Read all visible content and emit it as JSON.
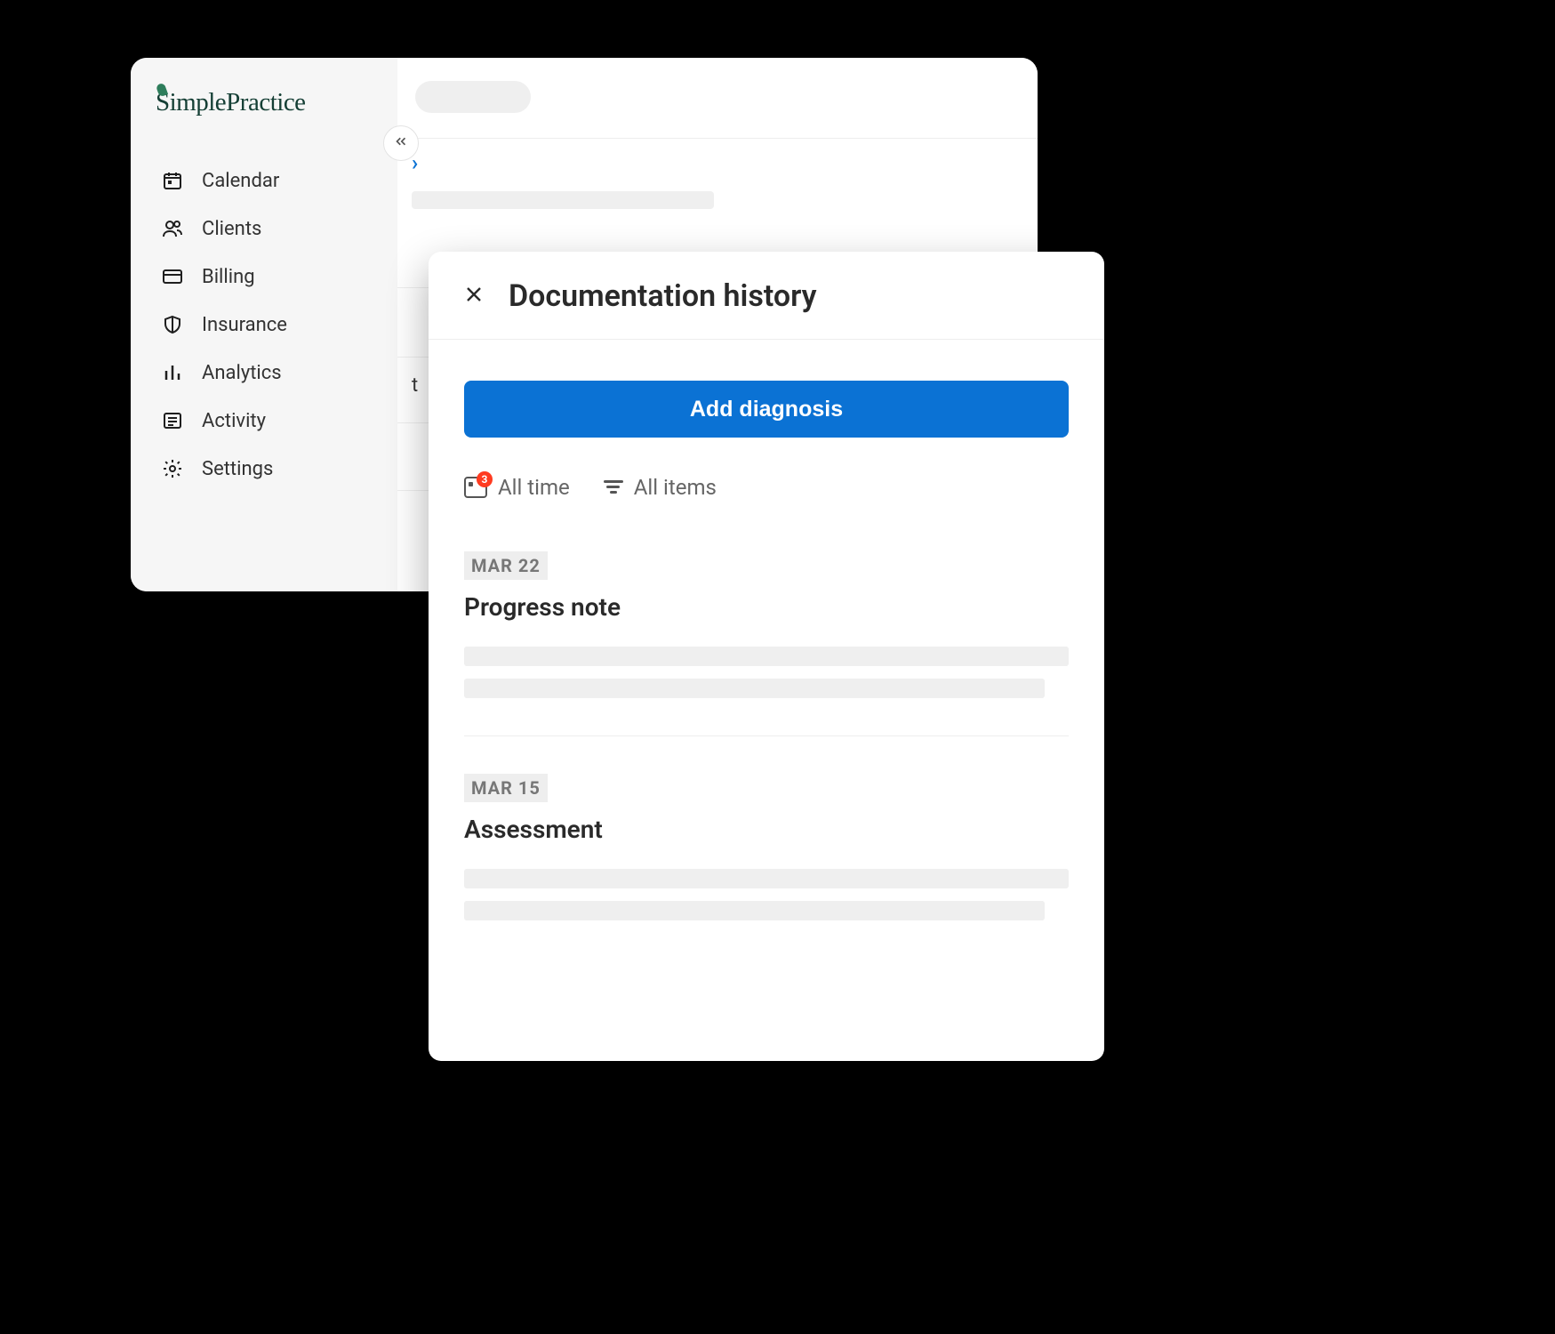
{
  "brand": {
    "name": "SimplePractice"
  },
  "sidebar": {
    "items": [
      {
        "label": "Calendar",
        "icon": "calendar"
      },
      {
        "label": "Clients",
        "icon": "clients"
      },
      {
        "label": "Billing",
        "icon": "billing"
      },
      {
        "label": "Insurance",
        "icon": "insurance"
      },
      {
        "label": "Analytics",
        "icon": "analytics"
      },
      {
        "label": "Activity",
        "icon": "activity"
      },
      {
        "label": "Settings",
        "icon": "settings"
      }
    ]
  },
  "background": {
    "partial_letter": "t"
  },
  "panel": {
    "title": "Documentation history",
    "primary_button": "Add diagnosis",
    "filters": {
      "time": {
        "label": "All time",
        "badge": "3"
      },
      "items": {
        "label": "All items"
      }
    },
    "entries": [
      {
        "date": "MAR 22",
        "title": "Progress note"
      },
      {
        "date": "MAR 15",
        "title": "Assessment"
      }
    ]
  },
  "colors": {
    "primary": "#0b72d4",
    "badge": "#ff3b20",
    "brand": "#153f35"
  }
}
